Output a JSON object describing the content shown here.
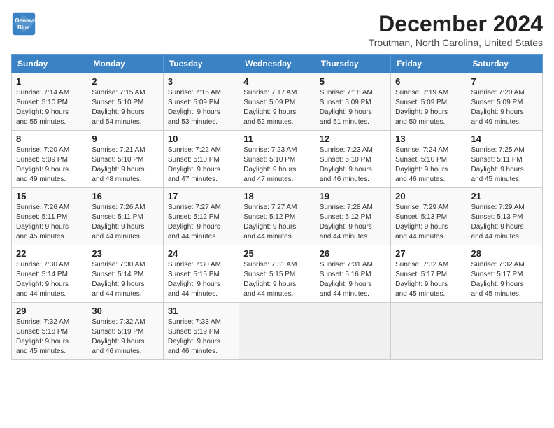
{
  "header": {
    "logo_line1": "General",
    "logo_line2": "Blue",
    "title": "December 2024",
    "subtitle": "Troutman, North Carolina, United States"
  },
  "days_of_week": [
    "Sunday",
    "Monday",
    "Tuesday",
    "Wednesday",
    "Thursday",
    "Friday",
    "Saturday"
  ],
  "weeks": [
    [
      {
        "day": "1",
        "info": "Sunrise: 7:14 AM\nSunset: 5:10 PM\nDaylight: 9 hours\nand 55 minutes."
      },
      {
        "day": "2",
        "info": "Sunrise: 7:15 AM\nSunset: 5:10 PM\nDaylight: 9 hours\nand 54 minutes."
      },
      {
        "day": "3",
        "info": "Sunrise: 7:16 AM\nSunset: 5:09 PM\nDaylight: 9 hours\nand 53 minutes."
      },
      {
        "day": "4",
        "info": "Sunrise: 7:17 AM\nSunset: 5:09 PM\nDaylight: 9 hours\nand 52 minutes."
      },
      {
        "day": "5",
        "info": "Sunrise: 7:18 AM\nSunset: 5:09 PM\nDaylight: 9 hours\nand 51 minutes."
      },
      {
        "day": "6",
        "info": "Sunrise: 7:19 AM\nSunset: 5:09 PM\nDaylight: 9 hours\nand 50 minutes."
      },
      {
        "day": "7",
        "info": "Sunrise: 7:20 AM\nSunset: 5:09 PM\nDaylight: 9 hours\nand 49 minutes."
      }
    ],
    [
      {
        "day": "8",
        "info": "Sunrise: 7:20 AM\nSunset: 5:09 PM\nDaylight: 9 hours\nand 49 minutes."
      },
      {
        "day": "9",
        "info": "Sunrise: 7:21 AM\nSunset: 5:10 PM\nDaylight: 9 hours\nand 48 minutes."
      },
      {
        "day": "10",
        "info": "Sunrise: 7:22 AM\nSunset: 5:10 PM\nDaylight: 9 hours\nand 47 minutes."
      },
      {
        "day": "11",
        "info": "Sunrise: 7:23 AM\nSunset: 5:10 PM\nDaylight: 9 hours\nand 47 minutes."
      },
      {
        "day": "12",
        "info": "Sunrise: 7:23 AM\nSunset: 5:10 PM\nDaylight: 9 hours\nand 46 minutes."
      },
      {
        "day": "13",
        "info": "Sunrise: 7:24 AM\nSunset: 5:10 PM\nDaylight: 9 hours\nand 46 minutes."
      },
      {
        "day": "14",
        "info": "Sunrise: 7:25 AM\nSunset: 5:11 PM\nDaylight: 9 hours\nand 45 minutes."
      }
    ],
    [
      {
        "day": "15",
        "info": "Sunrise: 7:26 AM\nSunset: 5:11 PM\nDaylight: 9 hours\nand 45 minutes."
      },
      {
        "day": "16",
        "info": "Sunrise: 7:26 AM\nSunset: 5:11 PM\nDaylight: 9 hours\nand 44 minutes."
      },
      {
        "day": "17",
        "info": "Sunrise: 7:27 AM\nSunset: 5:12 PM\nDaylight: 9 hours\nand 44 minutes."
      },
      {
        "day": "18",
        "info": "Sunrise: 7:27 AM\nSunset: 5:12 PM\nDaylight: 9 hours\nand 44 minutes."
      },
      {
        "day": "19",
        "info": "Sunrise: 7:28 AM\nSunset: 5:12 PM\nDaylight: 9 hours\nand 44 minutes."
      },
      {
        "day": "20",
        "info": "Sunrise: 7:29 AM\nSunset: 5:13 PM\nDaylight: 9 hours\nand 44 minutes."
      },
      {
        "day": "21",
        "info": "Sunrise: 7:29 AM\nSunset: 5:13 PM\nDaylight: 9 hours\nand 44 minutes."
      }
    ],
    [
      {
        "day": "22",
        "info": "Sunrise: 7:30 AM\nSunset: 5:14 PM\nDaylight: 9 hours\nand 44 minutes."
      },
      {
        "day": "23",
        "info": "Sunrise: 7:30 AM\nSunset: 5:14 PM\nDaylight: 9 hours\nand 44 minutes."
      },
      {
        "day": "24",
        "info": "Sunrise: 7:30 AM\nSunset: 5:15 PM\nDaylight: 9 hours\nand 44 minutes."
      },
      {
        "day": "25",
        "info": "Sunrise: 7:31 AM\nSunset: 5:15 PM\nDaylight: 9 hours\nand 44 minutes."
      },
      {
        "day": "26",
        "info": "Sunrise: 7:31 AM\nSunset: 5:16 PM\nDaylight: 9 hours\nand 44 minutes."
      },
      {
        "day": "27",
        "info": "Sunrise: 7:32 AM\nSunset: 5:17 PM\nDaylight: 9 hours\nand 45 minutes."
      },
      {
        "day": "28",
        "info": "Sunrise: 7:32 AM\nSunset: 5:17 PM\nDaylight: 9 hours\nand 45 minutes."
      }
    ],
    [
      {
        "day": "29",
        "info": "Sunrise: 7:32 AM\nSunset: 5:18 PM\nDaylight: 9 hours\nand 45 minutes."
      },
      {
        "day": "30",
        "info": "Sunrise: 7:32 AM\nSunset: 5:19 PM\nDaylight: 9 hours\nand 46 minutes."
      },
      {
        "day": "31",
        "info": "Sunrise: 7:33 AM\nSunset: 5:19 PM\nDaylight: 9 hours\nand 46 minutes."
      },
      null,
      null,
      null,
      null
    ]
  ]
}
